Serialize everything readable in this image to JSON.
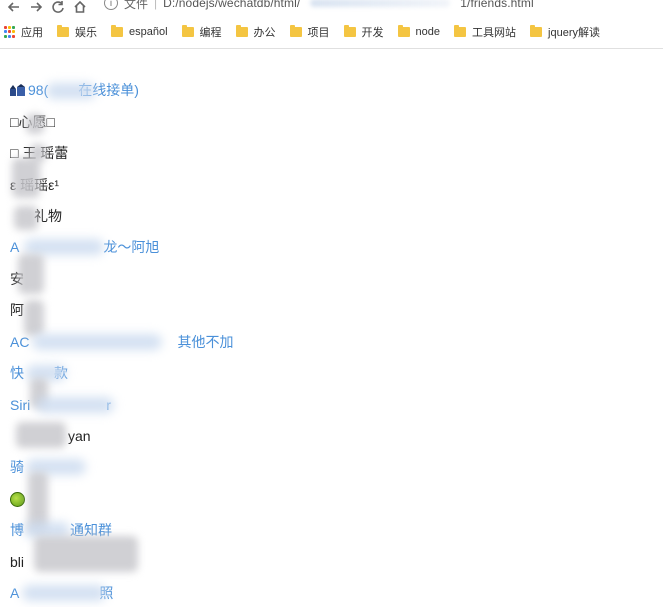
{
  "browser": {
    "address_prefix": "文件",
    "url": "D:/nodejs/wechatdb/html/",
    "url_tail": "1/friends.html"
  },
  "bookmarks": {
    "apps_label": "应用",
    "items": [
      {
        "label": "娱乐"
      },
      {
        "label": "español"
      },
      {
        "label": "编程"
      },
      {
        "label": "办公"
      },
      {
        "label": "项目"
      },
      {
        "label": "开发"
      },
      {
        "label": "node"
      },
      {
        "label": "工具网站"
      },
      {
        "label": "jquery解读"
      }
    ]
  },
  "friends": [
    {
      "text": "98(",
      "suffix": "在线接单)",
      "type": "link"
    },
    {
      "text": "□心愿□",
      "type": "plain"
    },
    {
      "text": "□ 王 瑶蕾",
      "type": "plain"
    },
    {
      "text": "ε 瑶瑶ε¹",
      "type": "plain"
    },
    {
      "text": "礼物",
      "type": "plain"
    },
    {
      "text": "A",
      "suffix": "龙～阿旭",
      "type": "link"
    },
    {
      "text": "安",
      "type": "plain"
    },
    {
      "text": "阿",
      "type": "plain"
    },
    {
      "text": "AC",
      "suffix": "其他不加",
      "type": "link"
    },
    {
      "text": "快",
      "suffix": "款",
      "type": "link"
    },
    {
      "text": "Siri",
      "suffix": "r",
      "type": "link"
    },
    {
      "text": "yan",
      "type": "plain"
    },
    {
      "text": "骑",
      "type": "link"
    },
    {
      "text": "",
      "type": "plain"
    },
    {
      "text": "博",
      "suffix": "通知群",
      "type": "link"
    },
    {
      "text": "bli",
      "type": "plain"
    },
    {
      "text": "A",
      "suffix": "照",
      "type": "link"
    }
  ]
}
